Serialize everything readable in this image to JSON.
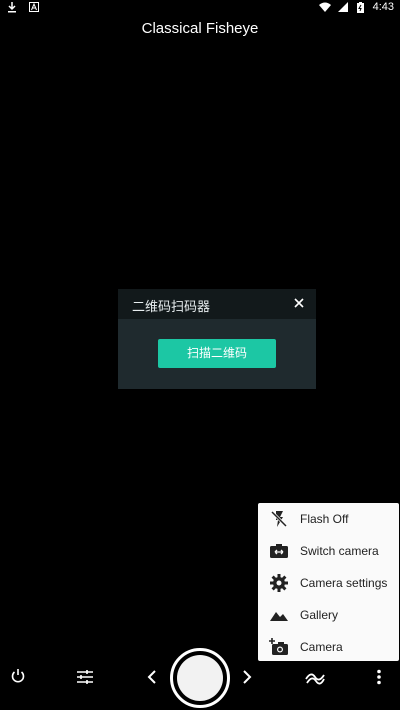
{
  "status_bar": {
    "time": "4:43",
    "icons": [
      "download-icon",
      "a-icon",
      "wifi-icon",
      "signal-icon",
      "battery-charging-icon"
    ]
  },
  "title": "Classical Fisheye",
  "qr_dialog": {
    "title": "二维码扫码器",
    "button_label": "扫描二维码"
  },
  "menu": {
    "items": [
      {
        "label": "Flash Off",
        "icon": "flash-off-icon"
      },
      {
        "label": "Switch camera",
        "icon": "switch-camera-icon"
      },
      {
        "label": "Camera settings",
        "icon": "gear-icon"
      },
      {
        "label": "Gallery",
        "icon": "gallery-icon"
      },
      {
        "label": "Camera",
        "icon": "add-camera-icon"
      }
    ]
  },
  "controls": {
    "icons": [
      "power-icon",
      "sliders-icon",
      "chevron-left-icon",
      "shutter-button",
      "chevron-right-icon",
      "effect-icon",
      "more-vert-icon"
    ]
  },
  "colors": {
    "accent": "#1cc7a4",
    "dialog_bg": "#1f2a2e",
    "dialog_header": "#12191b",
    "menu_bg": "#fafafa"
  }
}
